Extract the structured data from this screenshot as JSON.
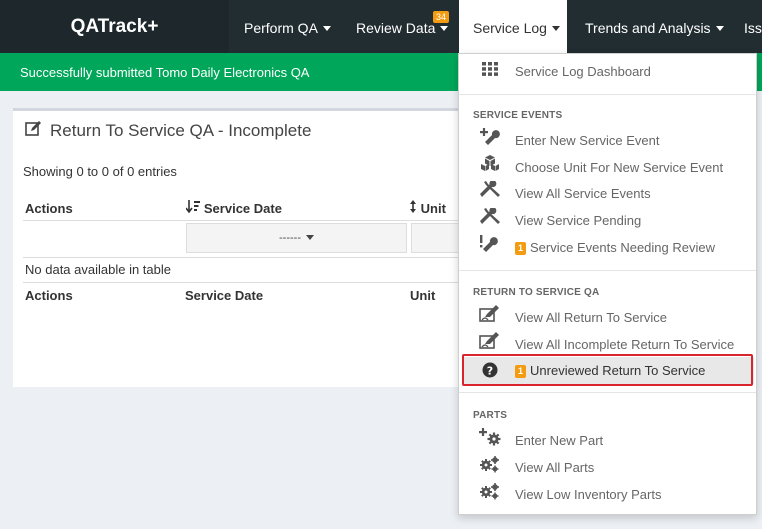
{
  "app": {
    "brand": "QATrack+"
  },
  "nav": {
    "perform_qa": "Perform QA",
    "review_data": "Review Data",
    "review_badge": "34",
    "service_log": "Service Log",
    "trends": "Trends and Analysis",
    "issues": "Iss"
  },
  "alert": {
    "text": "Successfully submitted Tomo Daily Electronics QA"
  },
  "box": {
    "title": "Return To Service QA - Incomplete",
    "info": "Showing 0 to 0 of 0 entries",
    "columns": [
      "Actions",
      "Service Date",
      "Unit"
    ],
    "filter_placeholder": "------",
    "no_data": "No data available in table"
  },
  "dropdown": {
    "dashboard": "Service Log Dashboard",
    "service_events_header": "SERVICE EVENTS",
    "enter_new_event": "Enter New Service Event",
    "choose_unit": "Choose Unit For New Service Event",
    "view_all_events": "View All Service Events",
    "view_pending": "View Service Pending",
    "needing_review_badge": "1",
    "needing_review": "Service Events Needing Review",
    "rts_header": "RETURN TO SERVICE QA",
    "view_all_rts": "View All Return To Service",
    "view_incomplete_rts": "View All Incomplete Return To Service",
    "unreviewed_badge": "1",
    "unreviewed_rts": "Unreviewed Return To Service",
    "parts_header": "PARTS",
    "enter_new_part": "Enter New Part",
    "view_all_parts": "View All Parts",
    "view_low_inventory": "View Low Inventory Parts"
  },
  "colors": {
    "navbar": "#222d32",
    "brand_bg": "#1e282c",
    "alert_green": "#00a65a",
    "badge_orange": "#f39c12",
    "highlight_red": "#d9232d"
  }
}
